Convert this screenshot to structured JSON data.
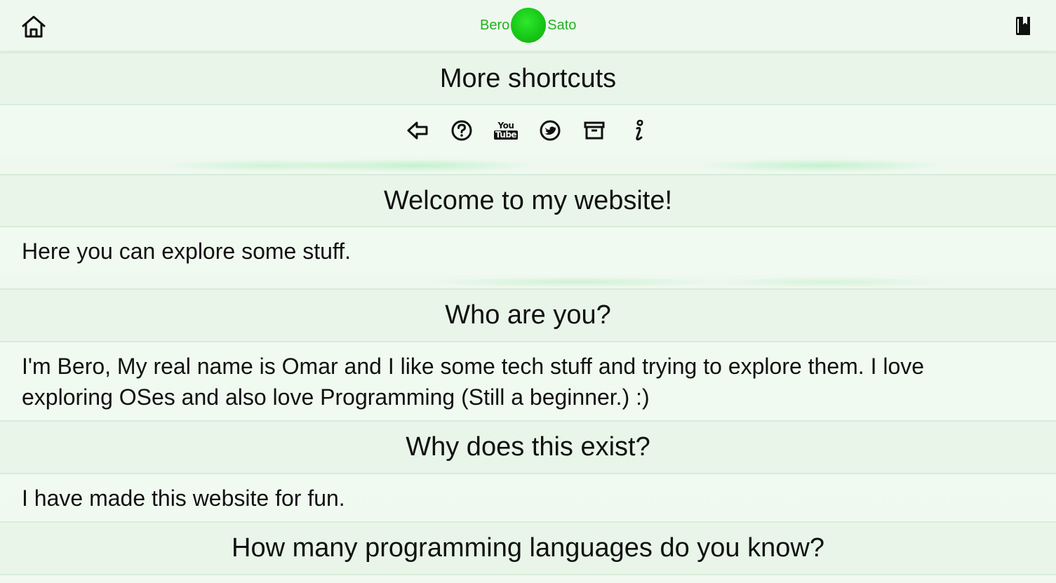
{
  "header": {
    "logo_left": "Bero",
    "logo_right": "Sato",
    "home_icon": "home-icon",
    "book_icon": "book-icon"
  },
  "shortcuts": {
    "title": "More shortcuts",
    "icons": [
      "arrow-left-icon",
      "question-circle-icon",
      "youtube-icon",
      "twitter-circle-icon",
      "archive-icon",
      "info-icon"
    ],
    "youtube_you": "You",
    "youtube_tube": "Tube"
  },
  "sections": [
    {
      "title": "Welcome to my website!",
      "body": "Here you can explore some stuff."
    },
    {
      "title": "Who are you?",
      "body": "I'm Bero, My real name is Omar and I like some tech stuff and trying to explore them. I love exploring OSes and also love Programming (Still a beginner.) :)"
    },
    {
      "title": "Why does this exist?",
      "body": "I have made this website for fun."
    },
    {
      "title": "How many programming languages do you know?",
      "body": ""
    }
  ],
  "colors": {
    "accent": "#1fb31f",
    "background": "#eef7ee",
    "band": "#e8f5e8"
  }
}
